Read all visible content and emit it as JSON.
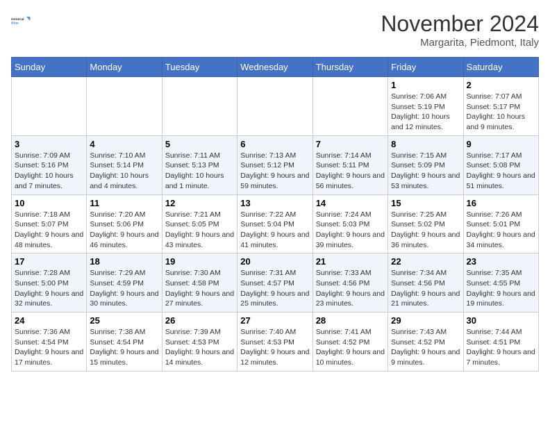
{
  "logo": {
    "line1": "General",
    "line2": "Blue"
  },
  "title": "November 2024",
  "subtitle": "Margarita, Piedmont, Italy",
  "weekdays": [
    "Sunday",
    "Monday",
    "Tuesday",
    "Wednesday",
    "Thursday",
    "Friday",
    "Saturday"
  ],
  "weeks": [
    [
      {
        "day": "",
        "info": ""
      },
      {
        "day": "",
        "info": ""
      },
      {
        "day": "",
        "info": ""
      },
      {
        "day": "",
        "info": ""
      },
      {
        "day": "",
        "info": ""
      },
      {
        "day": "1",
        "info": "Sunrise: 7:06 AM\nSunset: 5:19 PM\nDaylight: 10 hours and 12 minutes."
      },
      {
        "day": "2",
        "info": "Sunrise: 7:07 AM\nSunset: 5:17 PM\nDaylight: 10 hours and 9 minutes."
      }
    ],
    [
      {
        "day": "3",
        "info": "Sunrise: 7:09 AM\nSunset: 5:16 PM\nDaylight: 10 hours and 7 minutes."
      },
      {
        "day": "4",
        "info": "Sunrise: 7:10 AM\nSunset: 5:14 PM\nDaylight: 10 hours and 4 minutes."
      },
      {
        "day": "5",
        "info": "Sunrise: 7:11 AM\nSunset: 5:13 PM\nDaylight: 10 hours and 1 minute."
      },
      {
        "day": "6",
        "info": "Sunrise: 7:13 AM\nSunset: 5:12 PM\nDaylight: 9 hours and 59 minutes."
      },
      {
        "day": "7",
        "info": "Sunrise: 7:14 AM\nSunset: 5:11 PM\nDaylight: 9 hours and 56 minutes."
      },
      {
        "day": "8",
        "info": "Sunrise: 7:15 AM\nSunset: 5:09 PM\nDaylight: 9 hours and 53 minutes."
      },
      {
        "day": "9",
        "info": "Sunrise: 7:17 AM\nSunset: 5:08 PM\nDaylight: 9 hours and 51 minutes."
      }
    ],
    [
      {
        "day": "10",
        "info": "Sunrise: 7:18 AM\nSunset: 5:07 PM\nDaylight: 9 hours and 48 minutes."
      },
      {
        "day": "11",
        "info": "Sunrise: 7:20 AM\nSunset: 5:06 PM\nDaylight: 9 hours and 46 minutes."
      },
      {
        "day": "12",
        "info": "Sunrise: 7:21 AM\nSunset: 5:05 PM\nDaylight: 9 hours and 43 minutes."
      },
      {
        "day": "13",
        "info": "Sunrise: 7:22 AM\nSunset: 5:04 PM\nDaylight: 9 hours and 41 minutes."
      },
      {
        "day": "14",
        "info": "Sunrise: 7:24 AM\nSunset: 5:03 PM\nDaylight: 9 hours and 39 minutes."
      },
      {
        "day": "15",
        "info": "Sunrise: 7:25 AM\nSunset: 5:02 PM\nDaylight: 9 hours and 36 minutes."
      },
      {
        "day": "16",
        "info": "Sunrise: 7:26 AM\nSunset: 5:01 PM\nDaylight: 9 hours and 34 minutes."
      }
    ],
    [
      {
        "day": "17",
        "info": "Sunrise: 7:28 AM\nSunset: 5:00 PM\nDaylight: 9 hours and 32 minutes."
      },
      {
        "day": "18",
        "info": "Sunrise: 7:29 AM\nSunset: 4:59 PM\nDaylight: 9 hours and 30 minutes."
      },
      {
        "day": "19",
        "info": "Sunrise: 7:30 AM\nSunset: 4:58 PM\nDaylight: 9 hours and 27 minutes."
      },
      {
        "day": "20",
        "info": "Sunrise: 7:31 AM\nSunset: 4:57 PM\nDaylight: 9 hours and 25 minutes."
      },
      {
        "day": "21",
        "info": "Sunrise: 7:33 AM\nSunset: 4:56 PM\nDaylight: 9 hours and 23 minutes."
      },
      {
        "day": "22",
        "info": "Sunrise: 7:34 AM\nSunset: 4:56 PM\nDaylight: 9 hours and 21 minutes."
      },
      {
        "day": "23",
        "info": "Sunrise: 7:35 AM\nSunset: 4:55 PM\nDaylight: 9 hours and 19 minutes."
      }
    ],
    [
      {
        "day": "24",
        "info": "Sunrise: 7:36 AM\nSunset: 4:54 PM\nDaylight: 9 hours and 17 minutes."
      },
      {
        "day": "25",
        "info": "Sunrise: 7:38 AM\nSunset: 4:54 PM\nDaylight: 9 hours and 15 minutes."
      },
      {
        "day": "26",
        "info": "Sunrise: 7:39 AM\nSunset: 4:53 PM\nDaylight: 9 hours and 14 minutes."
      },
      {
        "day": "27",
        "info": "Sunrise: 7:40 AM\nSunset: 4:53 PM\nDaylight: 9 hours and 12 minutes."
      },
      {
        "day": "28",
        "info": "Sunrise: 7:41 AM\nSunset: 4:52 PM\nDaylight: 9 hours and 10 minutes."
      },
      {
        "day": "29",
        "info": "Sunrise: 7:43 AM\nSunset: 4:52 PM\nDaylight: 9 hours and 9 minutes."
      },
      {
        "day": "30",
        "info": "Sunrise: 7:44 AM\nSunset: 4:51 PM\nDaylight: 9 hours and 7 minutes."
      }
    ]
  ]
}
